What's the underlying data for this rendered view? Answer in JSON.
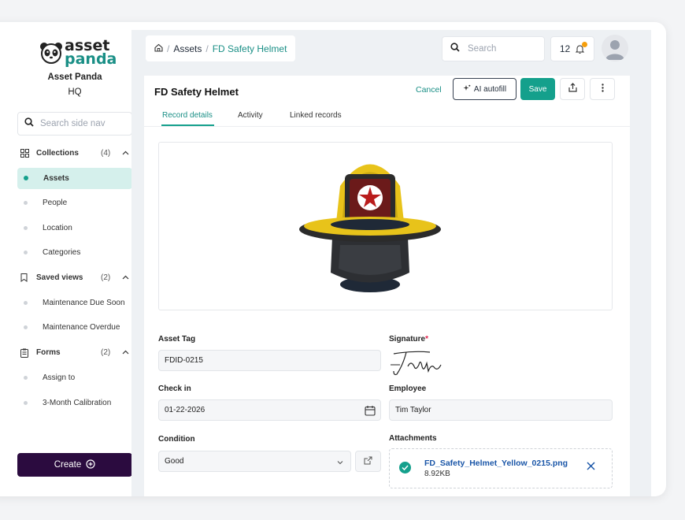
{
  "org": {
    "logo_line1": "asset",
    "logo_line2": "panda",
    "name": "Asset Panda",
    "sub": "HQ"
  },
  "sidebar": {
    "search_placeholder": "Search side nav",
    "sections": [
      {
        "label": "Collections",
        "count": "(4)",
        "items": [
          "Assets",
          "People",
          "Location",
          "Categories"
        ]
      },
      {
        "label": "Saved views",
        "count": "(2)",
        "items": [
          "Maintenance Due Soon",
          "Maintenance Overdue"
        ]
      },
      {
        "label": "Forms",
        "count": "(2)",
        "items": [
          "Assign to",
          "3-Month Calibration"
        ]
      }
    ],
    "create_label": "Create"
  },
  "topbar": {
    "breadcrumb": [
      "Assets",
      "FD Safety Helmet"
    ],
    "search_placeholder": "Search",
    "notification_count": "12"
  },
  "record": {
    "title": "FD Safety Helmet",
    "cancel_label": "Cancel",
    "ai_label": "AI autofill",
    "save_label": "Save",
    "tabs": [
      "Record details",
      "Activity",
      "Linked records"
    ],
    "fields": {
      "asset_tag_label": "Asset Tag",
      "asset_tag_value": "FDID-0215",
      "signature_label": "Signature",
      "checkin_label": "Check in",
      "checkin_value": "01-22-2026",
      "employee_label": "Employee",
      "employee_value": "Tim Taylor",
      "condition_label": "Condition",
      "condition_value": "Good",
      "attachments_label": "Attachments"
    },
    "attachment": {
      "filename": "FD_Safety_Helmet_Yellow_0215.png",
      "size": "8.92KB"
    }
  },
  "colors": {
    "accent": "#14a08c",
    "create": "#2b0b3f",
    "link": "#1a56a8"
  }
}
